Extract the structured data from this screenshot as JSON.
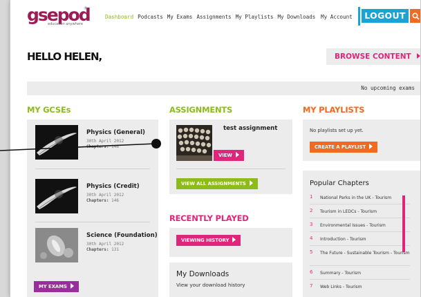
{
  "header": {
    "logo_text": "gsepod",
    "logo_tagline": "education anywhere",
    "logo_mark": "®",
    "nav": [
      {
        "label": "Dashboard",
        "active": true
      },
      {
        "label": "Podcasts"
      },
      {
        "label": "My Exams"
      },
      {
        "label": "Assignments"
      },
      {
        "label": "My Playlists"
      },
      {
        "label": "My Downloads"
      }
    ],
    "account_label": "My Account",
    "logout_label": "LOGOUT",
    "search_icon": "search-icon"
  },
  "greeting": "HELLO HELEN,",
  "browse_label": "BROWSE CONTENT",
  "exams_status": "No upcoming exams",
  "gcse": {
    "title": "MY GCSEs",
    "courses": [
      {
        "name": "Physics (General)",
        "date": "30th April 2012",
        "chapters_label": "Chapters:",
        "chapters": "146"
      },
      {
        "name": "Physics (Credit)",
        "date": "30th April 2012",
        "chapters_label": "Chapters:",
        "chapters": "146"
      },
      {
        "name": "Science (Foundation)",
        "date": "30th April 2012",
        "chapters_label": "Chapters:",
        "chapters": "131"
      }
    ],
    "my_exams_label": "MY EXAMS"
  },
  "assignments": {
    "title": "ASSIGNMENTS",
    "item_name": "test assignment",
    "view_label": "VIEW",
    "view_all_label": "VIEW ALL ASSIGNMENTS"
  },
  "recent": {
    "title": "RECENTLY PLAYED",
    "history_label": "VIEWING HISTORY"
  },
  "downloads": {
    "title": "My Downloads",
    "desc": "View your download history"
  },
  "playlists": {
    "title": "MY PLAYLISTS",
    "empty": "No playlists set up yet.",
    "create_label": "CREATE A PLAYLIST"
  },
  "popular": {
    "title": "Popular Chapters",
    "items": [
      {
        "num": "1",
        "text": "National Parks in the UK - Tourism"
      },
      {
        "num": "2",
        "text": "Tourism in LEDCs - Tourism"
      },
      {
        "num": "3",
        "text": "Environmental Issues - Tourism"
      },
      {
        "num": "4",
        "text": "Introduction - Tourism"
      },
      {
        "num": "5",
        "text": "The Future - Sustainable Tourism - Tourism"
      },
      {
        "num": "6",
        "text": "Summary - Tourism"
      },
      {
        "num": "7",
        "text": "Web Links - Tourism"
      }
    ]
  },
  "colors": {
    "green": "#8dbb1c",
    "pink": "#e0267a",
    "orange": "#f06a1f",
    "blue": "#1aa3d4",
    "purple": "#9b2e9c",
    "brand": "#9c1d56"
  }
}
